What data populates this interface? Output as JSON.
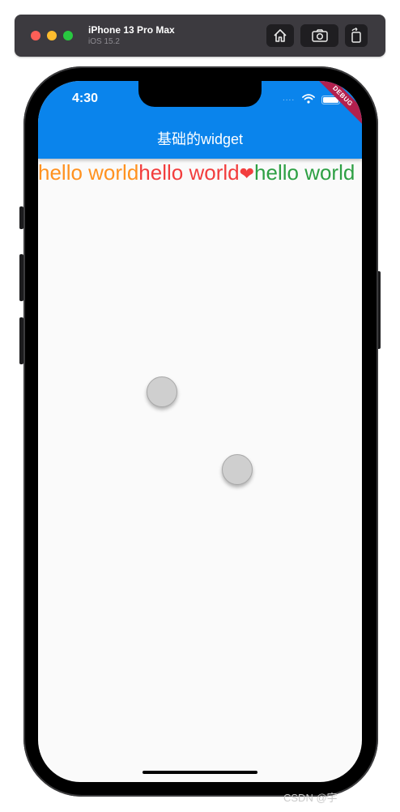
{
  "simulator": {
    "device_name": "iPhone 13 Pro Max",
    "os_version": "iOS 15.2",
    "buttons": [
      "home-icon",
      "screenshot-icon",
      "rotate-icon"
    ]
  },
  "status_bar": {
    "time": "4:30",
    "signal": "....",
    "icons": [
      "wifi-icon",
      "battery-icon"
    ]
  },
  "app_bar": {
    "title": "基础的widget",
    "color": "#0a84ec",
    "debug_label": "DEBUG"
  },
  "body": {
    "segments": [
      {
        "text": "hello world",
        "color": "#ff9220"
      },
      {
        "text": "hello world",
        "color": "#f23d3d"
      },
      {
        "text": "hello world",
        "color": "#2ea044"
      }
    ],
    "heart_glyph": "❤"
  },
  "watermark": "CSDN @宇"
}
